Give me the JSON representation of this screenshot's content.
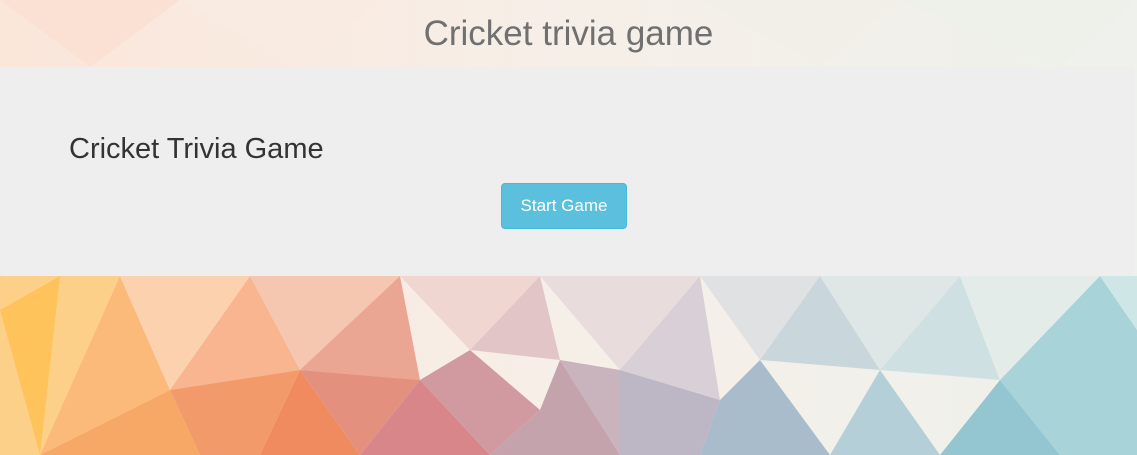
{
  "header": {
    "title": "Cricket trivia game"
  },
  "panel": {
    "heading": "Cricket Trivia Game",
    "start_button_label": "Start Game",
    "background_color": "#eeeeee"
  },
  "colors": {
    "button": "#5bc0de",
    "title_text": "#707070",
    "heading_text": "#333333"
  },
  "background": {
    "description_icon": "low-poly-gradient-background"
  }
}
